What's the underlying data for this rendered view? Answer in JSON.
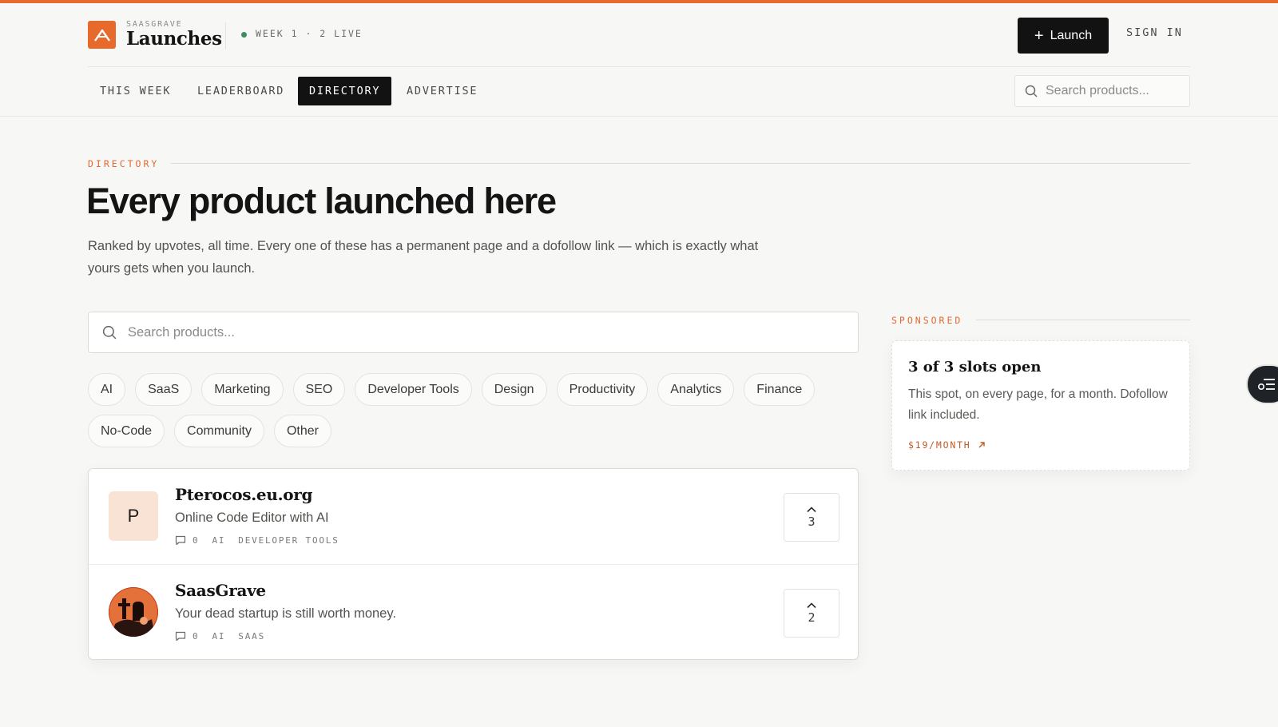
{
  "colors": {
    "accent": "#e8692c",
    "dark": "#121212",
    "live": "#3a8f5c"
  },
  "header": {
    "brand_small": "SAASGRAVE",
    "brand_big": "Launches",
    "live_status": "WEEK 1 · 2 LIVE",
    "launch_label": "Launch",
    "signin_label": "SIGN IN"
  },
  "nav": {
    "tabs": [
      {
        "label": "THIS WEEK"
      },
      {
        "label": "LEADERBOARD"
      },
      {
        "label": "DIRECTORY",
        "active": true
      },
      {
        "label": "ADVERTISE"
      }
    ],
    "search_placeholder": "Search products..."
  },
  "hero": {
    "eyebrow": "DIRECTORY",
    "title": "Every product launched here",
    "description": "Ranked by upvotes, all time. Every one of these has a permanent page and a dofollow link — which is exactly what yours gets when you launch."
  },
  "directory": {
    "search_placeholder": "Search products...",
    "categories": [
      "AI",
      "SaaS",
      "Marketing",
      "SEO",
      "Developer Tools",
      "Design",
      "Productivity",
      "Analytics",
      "Finance",
      "No-Code",
      "Community",
      "Other"
    ]
  },
  "products": [
    {
      "name": "Pterocos.eu.org",
      "tagline": "Online Code Editor with AI",
      "avatar_letter": "P",
      "comments": "0",
      "categories": [
        "AI",
        "DEVELOPER TOOLS"
      ],
      "upvotes": "3"
    },
    {
      "name": "SaasGrave",
      "tagline": "Your dead startup is still worth money.",
      "avatar_icon": "tombstone-logo-icon",
      "comments": "0",
      "categories": [
        "AI",
        "SAAS"
      ],
      "upvotes": "2"
    }
  ],
  "sponsored": {
    "eyebrow": "SPONSORED",
    "title": "3 of 3 slots open",
    "body": "This spot, on every page, for a month. Dofollow link included.",
    "price": "$19/MONTH"
  }
}
